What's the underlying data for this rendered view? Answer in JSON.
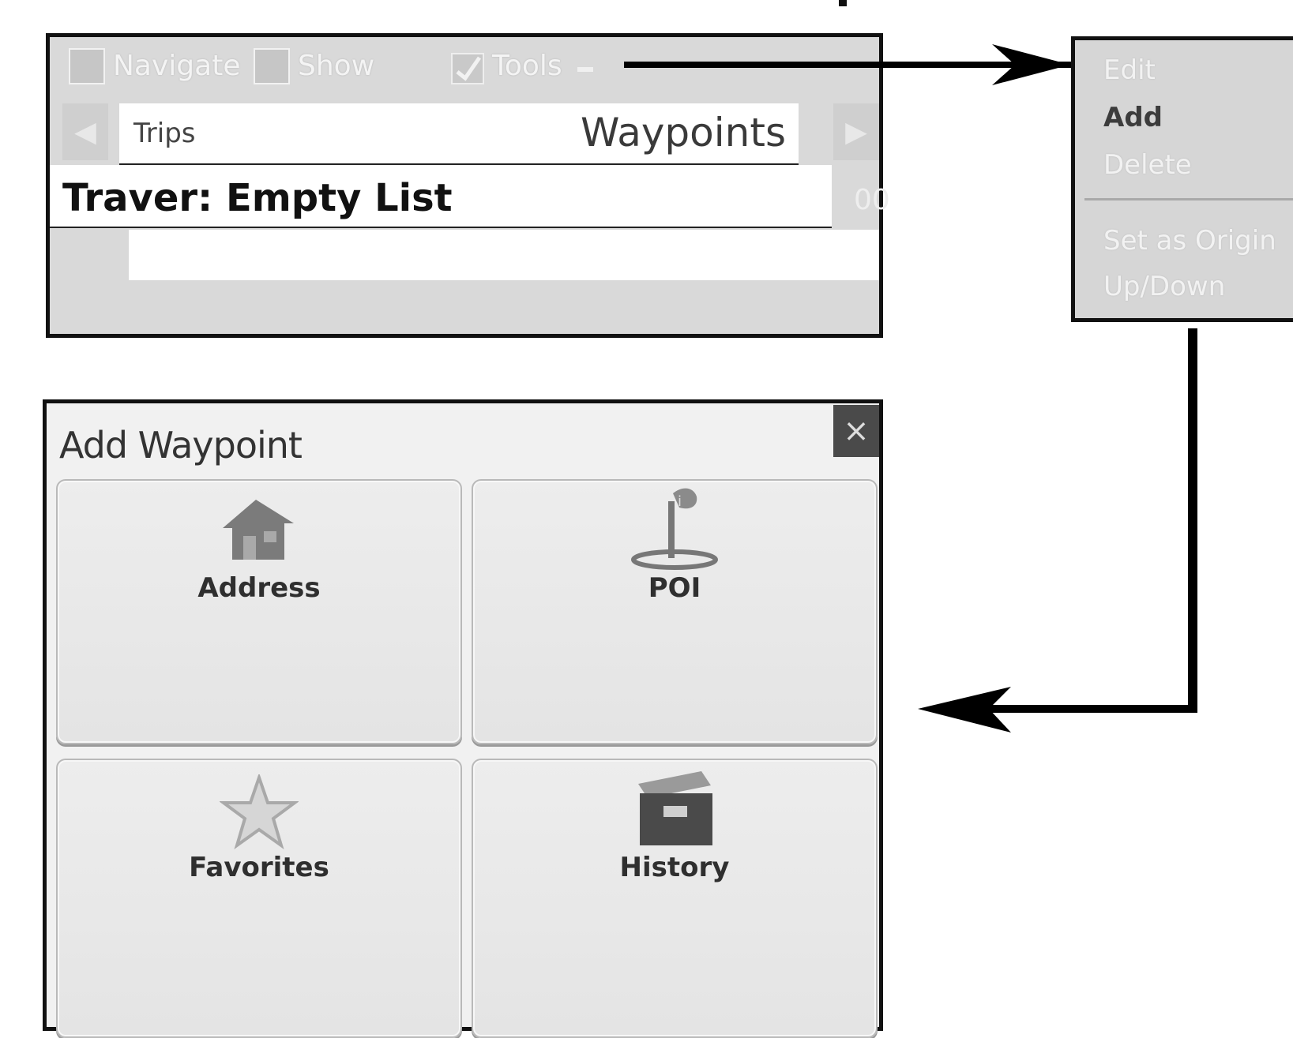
{
  "trip_window": {
    "toolbar": {
      "navigate_label": "Navigate",
      "show_label": "Show",
      "tools_label": "Tools"
    },
    "tabs": {
      "left": "Trips",
      "right": "Waypoints"
    },
    "right_edge_text": "00",
    "list_status": "Traver: Empty List"
  },
  "tools_menu": {
    "items": [
      {
        "label": "Edit",
        "enabled": false
      },
      {
        "label": "Add",
        "enabled": true
      },
      {
        "label": "Delete",
        "enabled": false
      },
      {
        "label": "Set as Origin",
        "enabled": false
      },
      {
        "label": "Up/Down",
        "enabled": false
      }
    ]
  },
  "add_waypoint": {
    "title": "Add Waypoint",
    "close_glyph": "×",
    "options": [
      {
        "label": "Address",
        "icon": "house-icon"
      },
      {
        "label": "POI",
        "icon": "poi-flag-icon"
      },
      {
        "label": "Favorites",
        "icon": "star-icon"
      },
      {
        "label": "History",
        "icon": "file-box-icon"
      }
    ]
  },
  "colors": {
    "frame": "#111111",
    "panel": "#d9d9d9",
    "connector": "#000000"
  }
}
